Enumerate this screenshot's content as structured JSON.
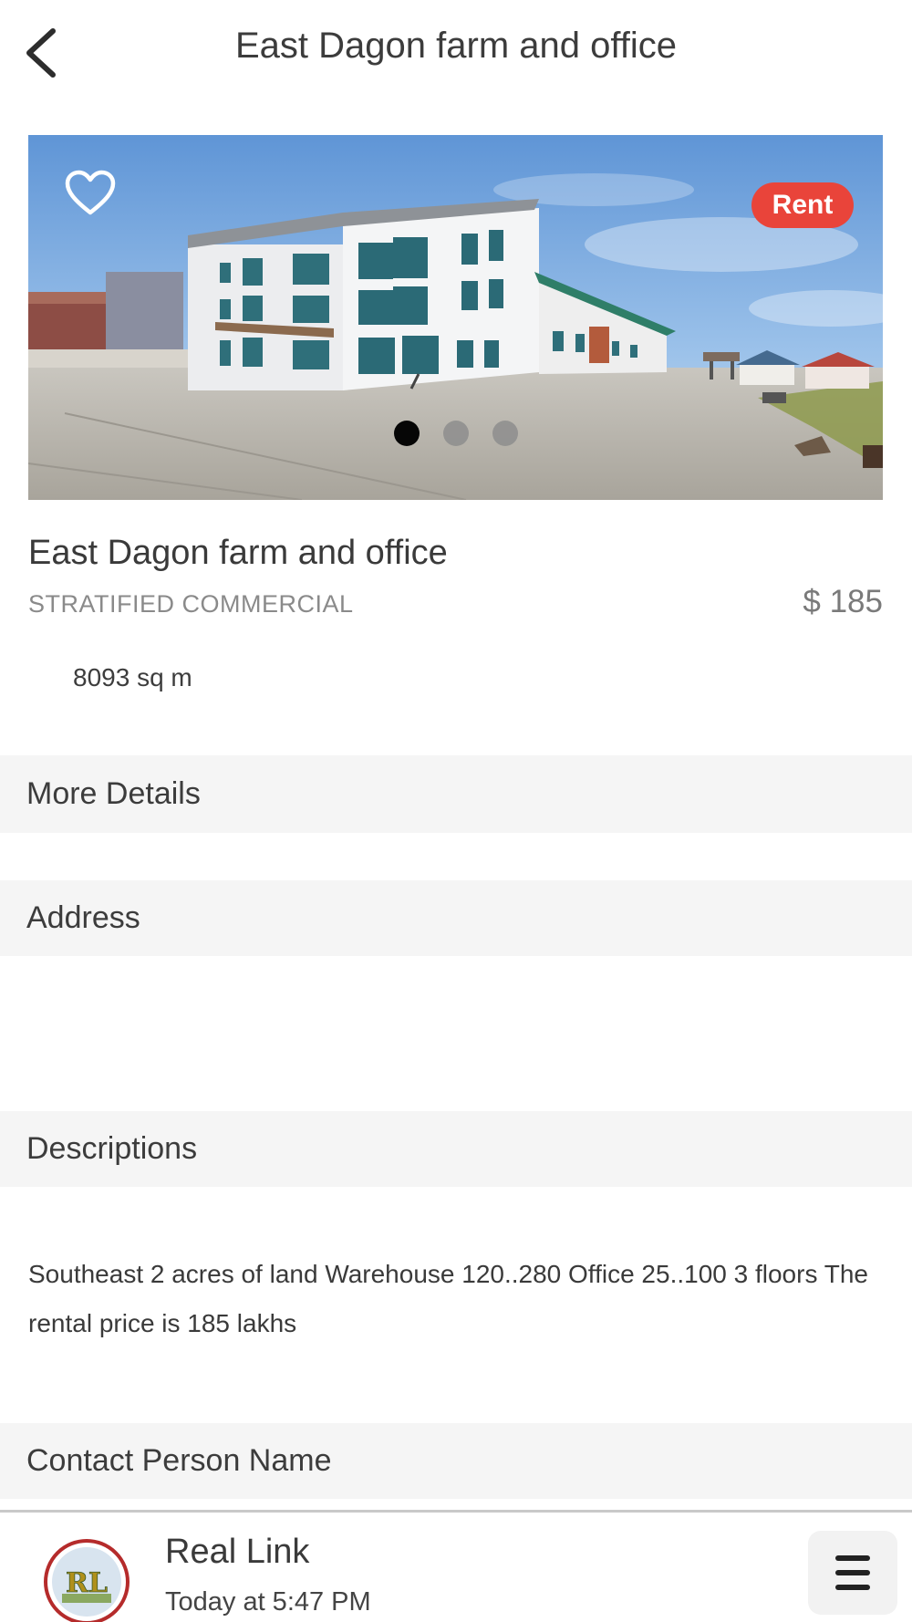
{
  "header": {
    "title": "East Dagon farm and office",
    "back_icon": "chevron-left-icon"
  },
  "carousel": {
    "badge": "Rent",
    "favorite_icon": "heart-outline-icon",
    "image_count": 3,
    "active_index": 0,
    "badge_color": "#e9443a"
  },
  "listing": {
    "title": "East Dagon farm and office",
    "category": "STRATIFIED COMMERCIAL",
    "price": "$ 185",
    "area": "8093 sq m"
  },
  "sections": {
    "more_details": "More Details",
    "address": "Address",
    "descriptions": "Descriptions",
    "contact_person": "Contact Person Name"
  },
  "description": {
    "text": "Southeast 2 acres of land Warehouse 120..280 Office 25..100 3 floors The rental price is 185 lakhs"
  },
  "bottom_bar": {
    "app_name": "Real Link",
    "timestamp": "Today at 5:47 PM",
    "logo_text": "RL",
    "menu_icon": "hamburger-menu-icon"
  }
}
